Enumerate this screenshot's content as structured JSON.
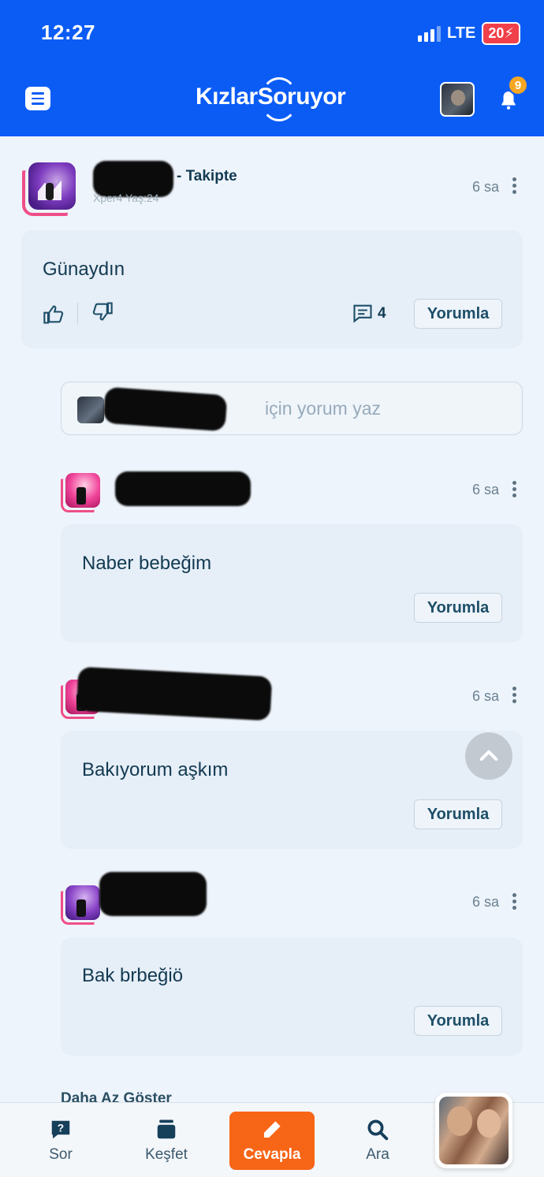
{
  "status_bar": {
    "time": "12:27",
    "network": "LTE",
    "battery": "20"
  },
  "header": {
    "logo": "KızlarSoruyor",
    "notification_count": "9"
  },
  "post": {
    "follow_label": "- Takipte",
    "meta": "Xper4 Yaş:24",
    "time": "6 sa",
    "text": "Günaydın",
    "comment_count": "4",
    "reply_label": "Yorumla"
  },
  "comment_input": {
    "placeholder": "için yorum yaz"
  },
  "replies": [
    {
      "time": "6 sa",
      "text": "Naber bebeğim",
      "reply_label": "Yorumla"
    },
    {
      "time": "6 sa",
      "text": "Bakıyorum aşkım",
      "reply_label": "Yorumla"
    },
    {
      "time": "6 sa",
      "text": "Bak brbeğiö",
      "reply_label": "Yorumla"
    }
  ],
  "show_less": "Daha Az Göster",
  "bottom_nav": {
    "items": [
      {
        "label": "Sor",
        "icon": "question-bubble-icon"
      },
      {
        "label": "Keşfet",
        "icon": "stack-icon"
      },
      {
        "label": "Cevapla",
        "icon": "pencil-icon"
      },
      {
        "label": "Ara",
        "icon": "search-icon"
      }
    ]
  },
  "colors": {
    "brand": "#0a5cf5",
    "accent": "#f76516",
    "badge": "#f5a623",
    "avatar_frame": "#ef4e87"
  }
}
